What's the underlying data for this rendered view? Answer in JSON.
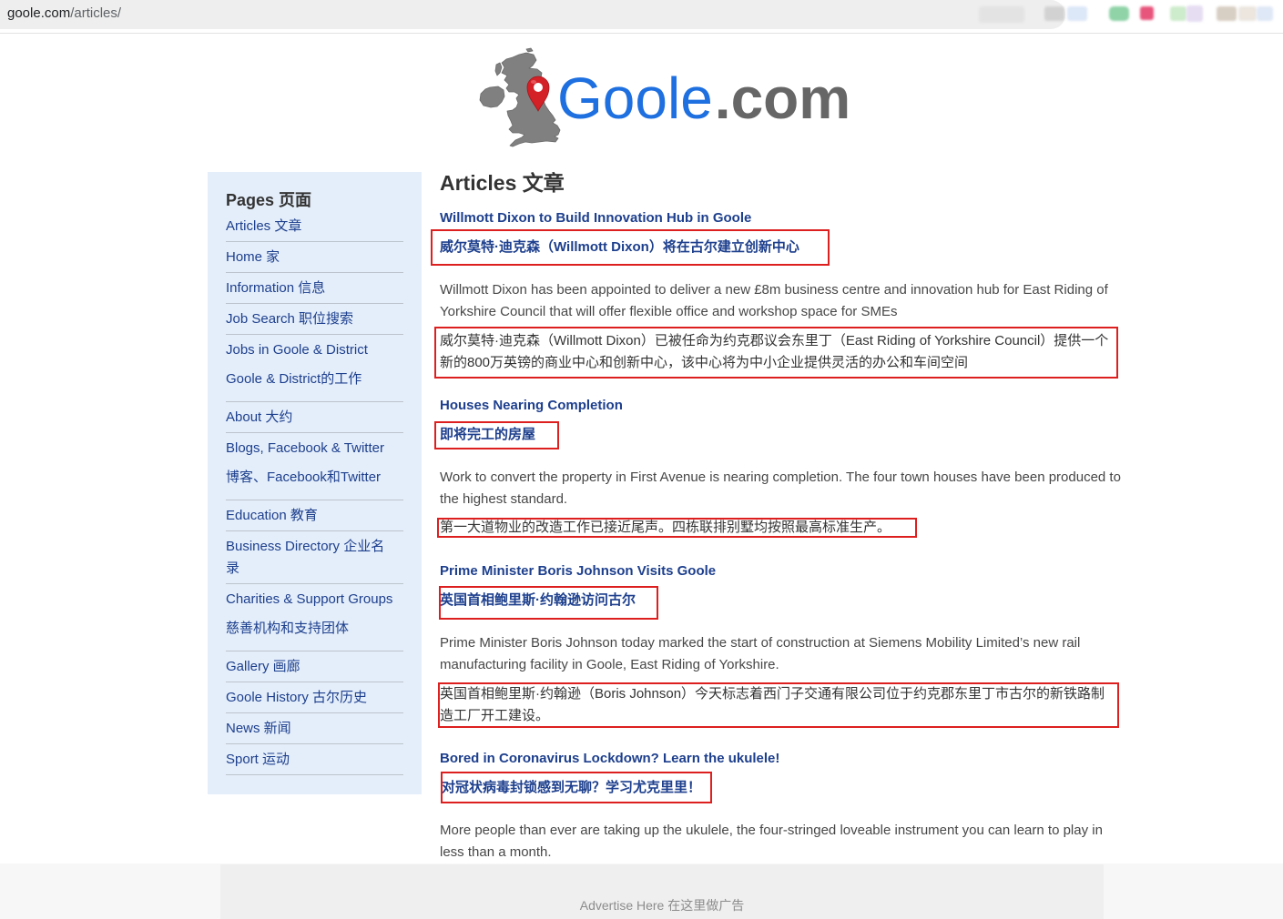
{
  "browser": {
    "url_host": "goole.com",
    "url_path": "/articles/"
  },
  "logo": {
    "name": "Goole",
    "tld": ".com",
    "icon": "uk-map-pin-icon"
  },
  "sidebar": {
    "heading": "Pages 页面",
    "items": [
      {
        "label": "Articles 文章"
      },
      {
        "label": "Home 家"
      },
      {
        "label": "Information 信息"
      },
      {
        "label": "Job Search 职位搜索"
      },
      {
        "label": "Jobs in Goole & District",
        "translation": "Goole & District的工作"
      },
      {
        "label": "About 大约"
      },
      {
        "label": "Blogs, Facebook & Twitter",
        "translation": "博客、Facebook和Twitter"
      },
      {
        "label": "Education 教育"
      },
      {
        "label": "Business Directory 企业名录"
      },
      {
        "label": "Charities & Support Groups",
        "translation": "慈善机构和支持团体"
      },
      {
        "label": "Gallery 画廊"
      },
      {
        "label": "Goole History 古尔历史"
      },
      {
        "label": "News 新闻"
      },
      {
        "label": "Sport 运动"
      }
    ]
  },
  "main": {
    "heading": "Articles 文章",
    "articles": [
      {
        "title": "Willmott Dixon to Build Innovation Hub in Goole",
        "title_translation": "威尔莫特·迪克森（Willmott Dixon）将在古尔建立创新中心",
        "summary": "Willmott Dixon has been appointed to deliver a new £8m business centre and innovation hub for East Riding of Yorkshire Council that will offer flexible office and workshop space for SMEs",
        "summary_translation": "威尔莫特·迪克森（Willmott Dixon）已被任命为约克郡议会东里丁（East Riding of Yorkshire Council）提供一个新的800万英镑的商业中心和创新中心，该中心将为中小企业提供灵活的办公和车间空间"
      },
      {
        "title": "Houses Nearing Completion",
        "title_translation": "即将完工的房屋",
        "summary": "Work to convert the property in First Avenue is nearing completion. The four town houses have been produced to the highest standard.",
        "summary_translation": "第一大道物业的改造工作已接近尾声。四栋联排别墅均按照最高标准生产。"
      },
      {
        "title": "Prime Minister Boris Johnson Visits Goole",
        "title_translation": "英国首相鲍里斯·约翰逊访问古尔",
        "summary": "Prime Minister Boris Johnson today marked the start of construction at Siemens Mobility Limited’s new rail manufacturing facility in Goole, East Riding of Yorkshire.",
        "summary_translation": "英国首相鲍里斯·约翰逊（Boris Johnson）今天标志着西门子交通有限公司位于约克郡东里丁市古尔的新铁路制造工厂开工建设。"
      },
      {
        "title": "Bored in Coronavirus Lockdown? Learn the ukulele!",
        "title_translation": "对冠状病毒封锁感到无聊？学习尤克里里！",
        "summary": "More people than ever are taking up the ukulele, the four-stringed loveable instrument you can learn to play in less than a month."
      }
    ]
  },
  "ad": {
    "label": "Advertise Here 在这里做广告"
  },
  "colors": {
    "link": "#1d3f8d",
    "logo_blue": "#1e6fe0",
    "logo_gray": "#666666",
    "annotation_red": "#dd1f1f",
    "sidebar_bg": "#e4eefa"
  }
}
